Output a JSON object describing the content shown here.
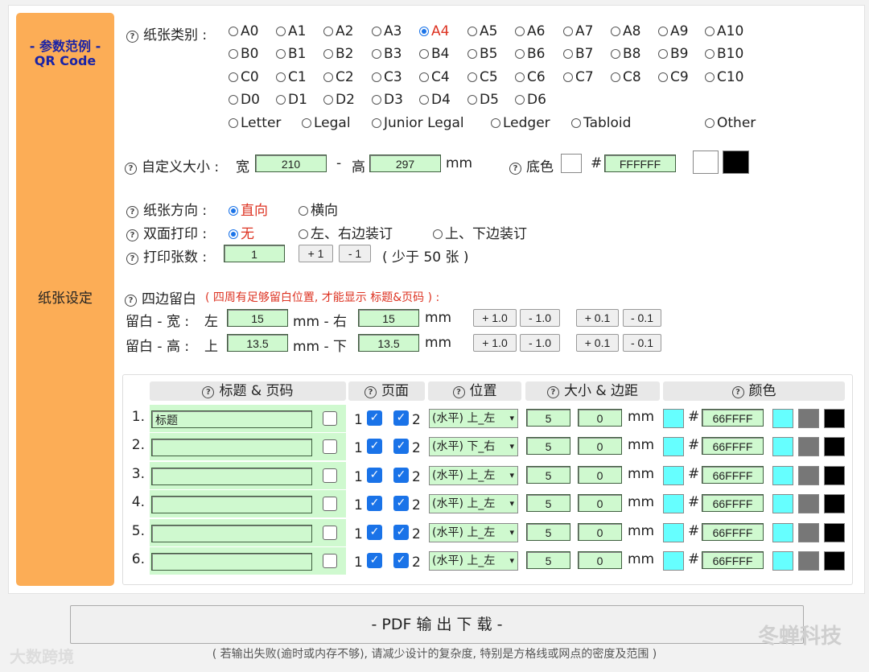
{
  "sidebar": {
    "link1": "- 参数范例 -",
    "link2": "QR Code",
    "title": "纸张设定"
  },
  "paper": {
    "label": "纸张类别 :",
    "rows": [
      [
        "A0",
        "A1",
        "A2",
        "A3",
        "A4",
        "A5",
        "A6",
        "A7",
        "A8",
        "A9",
        "A10"
      ],
      [
        "B0",
        "B1",
        "B2",
        "B3",
        "B4",
        "B5",
        "B6",
        "B7",
        "B8",
        "B9",
        "B10"
      ],
      [
        "C0",
        "C1",
        "C2",
        "C3",
        "C4",
        "C5",
        "C6",
        "C7",
        "C8",
        "C9",
        "C10"
      ],
      [
        "D0",
        "D1",
        "D2",
        "D3",
        "D4",
        "D5",
        "D6"
      ]
    ],
    "selected": "A4",
    "named": [
      "Letter",
      "Legal",
      "Junior Legal",
      "Ledger",
      "Tabloid"
    ],
    "other": "Other"
  },
  "custom": {
    "label": "自定义大小 :",
    "w_label": "宽",
    "dash": "-",
    "h_label": "高",
    "width": "210",
    "height": "297",
    "unit": "mm",
    "bg_label": "底色",
    "hash": "#",
    "bg_value": "FFFFFF"
  },
  "orientation": {
    "label": "纸张方向 :",
    "opt1": "直向",
    "opt2": "横向"
  },
  "duplex": {
    "label": "双面打印 :",
    "opt1": "无",
    "opt2": "左、右边装订",
    "opt3": "上、下边装订"
  },
  "copies": {
    "label": "打印张数 :",
    "value": "1",
    "plus": "+ 1",
    "minus": "- 1",
    "note": "( 少于 50 张 )"
  },
  "margins": {
    "title": "四边留白",
    "hint": "( 四周有足够留白位置, 才能显示 标题&页码 ) :",
    "w_row": {
      "label": "留白 - 宽 :",
      "a": "左",
      "a_val": "15",
      "mid": "mm - 右",
      "b_val": "15",
      "unit": "mm"
    },
    "h_row": {
      "label": "留白 - 高 :",
      "a": "上",
      "a_val": "13.5",
      "mid": "mm - 下",
      "b_val": "13.5",
      "unit": "mm"
    },
    "btns": [
      "+ 1.0",
      "- 1.0",
      "+ 0.1",
      "- 0.1"
    ]
  },
  "table": {
    "headers": [
      "标题 & 页码",
      "页面",
      "位置",
      "大小 & 边距",
      "颜色"
    ],
    "rows": [
      {
        "n": "1.",
        "title": "标题",
        "p1": "1",
        "p2": "2",
        "pos": "(水平) 上_左",
        "size": "5",
        "margin": "0",
        "unit": "mm",
        "hash": "#",
        "color": "66FFFF"
      },
      {
        "n": "2.",
        "title": "",
        "p1": "1",
        "p2": "2",
        "pos": "(水平) 下_右",
        "size": "5",
        "margin": "0",
        "unit": "mm",
        "hash": "#",
        "color": "66FFFF"
      },
      {
        "n": "3.",
        "title": "",
        "p1": "1",
        "p2": "2",
        "pos": "(水平) 上_左",
        "size": "5",
        "margin": "0",
        "unit": "mm",
        "hash": "#",
        "color": "66FFFF"
      },
      {
        "n": "4.",
        "title": "",
        "p1": "1",
        "p2": "2",
        "pos": "(水平) 上_左",
        "size": "5",
        "margin": "0",
        "unit": "mm",
        "hash": "#",
        "color": "66FFFF"
      },
      {
        "n": "5.",
        "title": "",
        "p1": "1",
        "p2": "2",
        "pos": "(水平) 上_左",
        "size": "5",
        "margin": "0",
        "unit": "mm",
        "hash": "#",
        "color": "66FFFF"
      },
      {
        "n": "6.",
        "title": "",
        "p1": "1",
        "p2": "2",
        "pos": "(水平) 上_左",
        "size": "5",
        "margin": "0",
        "unit": "mm",
        "hash": "#",
        "color": "66FFFF"
      }
    ]
  },
  "pdf": {
    "label": "- PDF 输 出 下 载 -",
    "note": "( 若输出失败(逾时或内存不够), 请减少设计的复杂度, 特别是方格线或网点的密度及范围 )"
  },
  "watermark": {
    "left": "大数跨境",
    "right": "冬蝉科技"
  },
  "colors": {
    "accent": "#fcad56",
    "link": "#1a23a6",
    "input_bg": "#cff9cf",
    "swatch_cyan": "#66ffff"
  }
}
